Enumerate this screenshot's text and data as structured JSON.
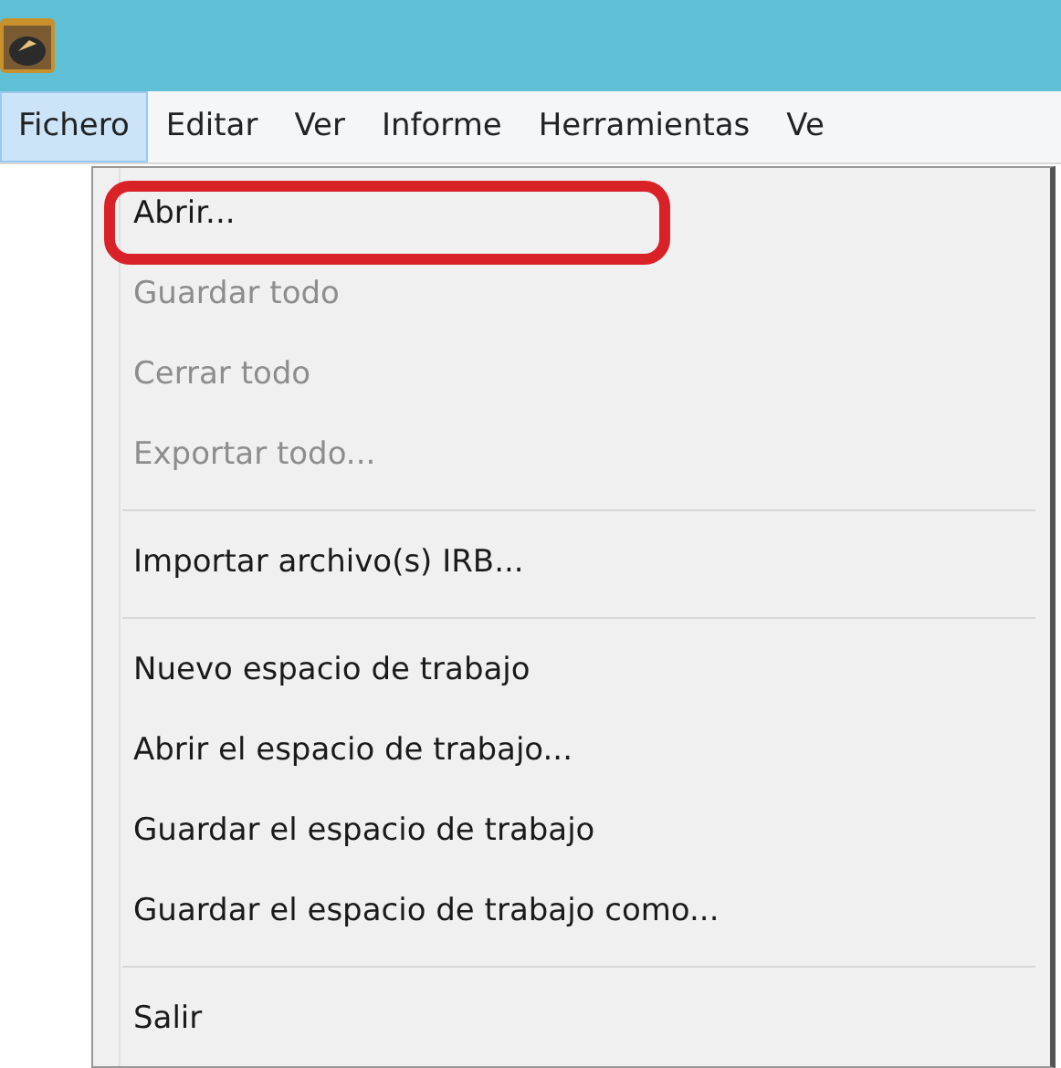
{
  "menu_bar": [
    {
      "label": "Fichero",
      "selected": true
    },
    {
      "label": "Editar",
      "selected": false
    },
    {
      "label": "Ver",
      "selected": false
    },
    {
      "label": "Informe",
      "selected": false
    },
    {
      "label": "Herramientas",
      "selected": false
    },
    {
      "label": "Ve",
      "selected": false
    }
  ],
  "menu": [
    {
      "kind": "item",
      "label": "Abrir...",
      "disabled": false,
      "annotated": true
    },
    {
      "kind": "item",
      "label": "Guardar todo",
      "disabled": true,
      "annotated": false
    },
    {
      "kind": "item",
      "label": "Cerrar todo",
      "disabled": true,
      "annotated": false
    },
    {
      "kind": "item",
      "label": "Exportar todo...",
      "disabled": true,
      "annotated": false
    },
    {
      "kind": "separator"
    },
    {
      "kind": "item",
      "label": "Importar archivo(s) IRB...",
      "disabled": false,
      "annotated": false
    },
    {
      "kind": "separator"
    },
    {
      "kind": "item",
      "label": "Nuevo espacio de trabajo",
      "disabled": false,
      "annotated": false
    },
    {
      "kind": "item",
      "label": "Abrir el espacio de trabajo...",
      "disabled": false,
      "annotated": false
    },
    {
      "kind": "item",
      "label": "Guardar el espacio de trabajo",
      "disabled": false,
      "annotated": false
    },
    {
      "kind": "item",
      "label": "Guardar el espacio de trabajo como...",
      "disabled": false,
      "annotated": false
    },
    {
      "kind": "separator"
    },
    {
      "kind": "item",
      "label": "Salir",
      "disabled": false,
      "annotated": false
    }
  ]
}
